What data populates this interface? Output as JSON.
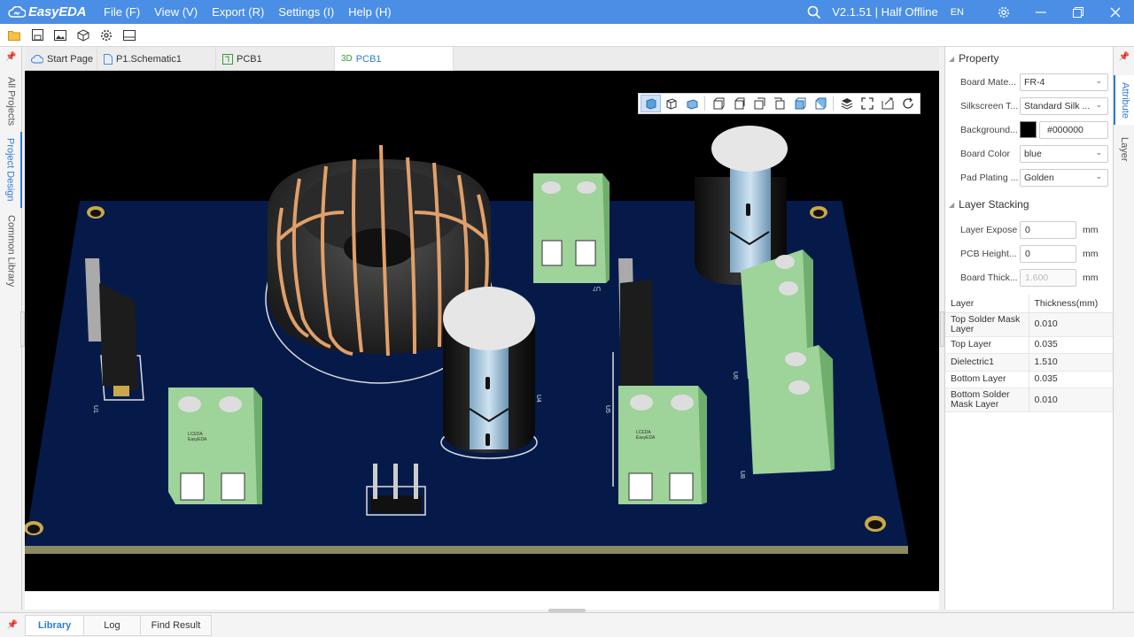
{
  "app": {
    "name": "EasyEDA",
    "version": "V2.1.51 | Half Offline",
    "lang": "EN"
  },
  "menu": [
    "File (F)",
    "View (V)",
    "Export (R)",
    "Settings (I)",
    "Help (H)"
  ],
  "left_tabs": [
    "All Projects",
    "Project Design",
    "Common Library"
  ],
  "doc_tabs": [
    {
      "label": "Start Page",
      "icon": "cloud-icon"
    },
    {
      "label": "P1.Schematic1",
      "icon": "document-icon"
    },
    {
      "label": "PCB1",
      "icon": "pcb-icon"
    },
    {
      "label": "PCB1",
      "icon": "3d-icon",
      "prefix": "3D"
    }
  ],
  "viewport": {
    "background": "#000000",
    "board_color": "#061a4a",
    "silkscreen_labels": [
      "U7",
      "U4",
      "U6",
      "U5",
      "U8",
      "U1"
    ]
  },
  "property": {
    "title": "Property",
    "rows": [
      {
        "label": "Board Mate...",
        "value": "FR-4"
      },
      {
        "label": "Silkscreen T...",
        "value": "Standard Silk ..."
      },
      {
        "label": "Background...",
        "value": "#000000"
      },
      {
        "label": "Board Color",
        "value": "blue"
      },
      {
        "label": "Pad Plating ...",
        "value": "Golden"
      }
    ]
  },
  "layer_stacking": {
    "title": "Layer Stacking",
    "rows": [
      {
        "label": "Layer Expose",
        "value": "0",
        "unit": "mm"
      },
      {
        "label": "PCB Height...",
        "value": "0",
        "unit": "mm"
      },
      {
        "label": "Board Thick...",
        "value": "1.600",
        "unit": "mm"
      }
    ],
    "table_headers": [
      "Layer",
      "Thickness(mm)"
    ],
    "table": [
      {
        "layer": "Top Solder Mask Layer",
        "thickness": "0.010"
      },
      {
        "layer": "Top Layer",
        "thickness": "0.035"
      },
      {
        "layer": "Dielectric1",
        "thickness": "1.510"
      },
      {
        "layer": "Bottom Layer",
        "thickness": "0.035"
      },
      {
        "layer": "Bottom Solder Mask Layer",
        "thickness": "0.010"
      }
    ]
  },
  "right_tabs": [
    "Attribute",
    "Layer"
  ],
  "bottom_tabs": [
    "Library",
    "Log",
    "Find Result"
  ]
}
